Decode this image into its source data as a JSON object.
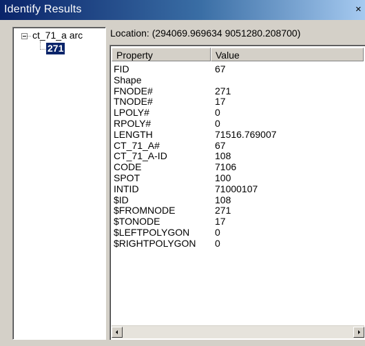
{
  "window": {
    "title": "Identify Results",
    "close_glyph": "×"
  },
  "tree": {
    "expander": "−",
    "root_label": "ct_71_a arc",
    "selected_child": "271"
  },
  "location": {
    "text": "Location: (294069.969634  9051280.208700)"
  },
  "table": {
    "columns": [
      "Property",
      "Value"
    ],
    "rows": [
      {
        "property": "FID",
        "value": "67"
      },
      {
        "property": "Shape",
        "value": ""
      },
      {
        "property": "FNODE#",
        "value": "271"
      },
      {
        "property": "TNODE#",
        "value": "17"
      },
      {
        "property": "LPOLY#",
        "value": "0"
      },
      {
        "property": "RPOLY#",
        "value": "0"
      },
      {
        "property": "LENGTH",
        "value": "71516.769007"
      },
      {
        "property": "CT_71_A#",
        "value": "67"
      },
      {
        "property": "CT_71_A-ID",
        "value": "108"
      },
      {
        "property": "CODE",
        "value": "7106"
      },
      {
        "property": "SPOT",
        "value": "100"
      },
      {
        "property": "INTID",
        "value": "71000107"
      },
      {
        "property": "$ID",
        "value": "108"
      },
      {
        "property": "$FROMNODE",
        "value": "271"
      },
      {
        "property": "$TONODE",
        "value": "17"
      },
      {
        "property": "$LEFTPOLYGON",
        "value": "0"
      },
      {
        "property": "$RIGHTPOLYGON",
        "value": "0"
      }
    ]
  },
  "icons": {
    "close": "close-icon",
    "expander": "collapse-icon",
    "scroll_left": "arrow-left-icon",
    "scroll_right": "arrow-right-icon"
  },
  "colors": {
    "titlebar_start": "#0a246a",
    "titlebar_end": "#a6caf0",
    "selection": "#0a246a",
    "face": "#d4d0c8"
  }
}
